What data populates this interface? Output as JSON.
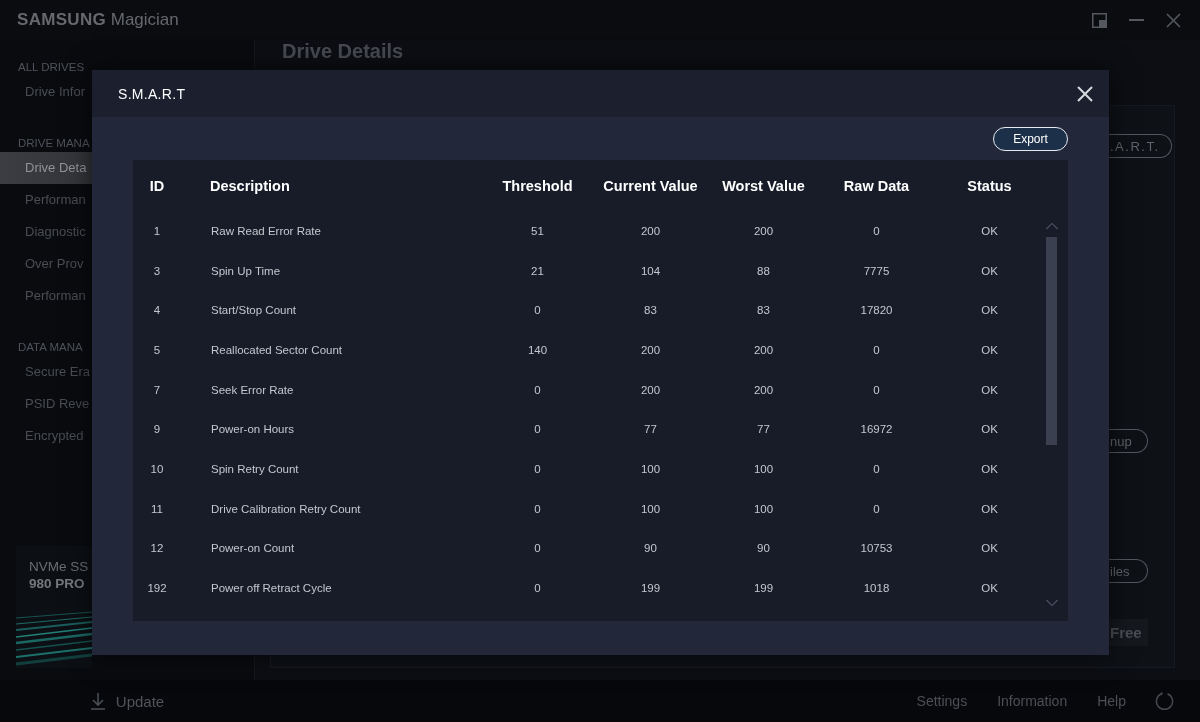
{
  "window": {
    "brand": "SAMSUNG",
    "title": "Magician"
  },
  "sidebar": {
    "sections": [
      {
        "heading": "ALL DRIVES",
        "items": [
          {
            "label": "Drive Infor",
            "selected": false
          }
        ]
      },
      {
        "heading": "DRIVE MANA",
        "items": [
          {
            "label": "Drive Deta",
            "selected": true
          },
          {
            "label": "Performan",
            "selected": false
          },
          {
            "label": "Diagnostic",
            "selected": false
          },
          {
            "label": "Over Prov",
            "selected": false
          },
          {
            "label": "Performan",
            "selected": false
          }
        ]
      },
      {
        "heading": "DATA MANA",
        "items": [
          {
            "label": "Secure Era",
            "selected": false
          },
          {
            "label": "PSID Reve",
            "selected": false
          },
          {
            "label": "Encrypted",
            "selected": false
          }
        ]
      }
    ],
    "banner": {
      "lines": [
        "NVMe SS",
        "980 PRO"
      ]
    },
    "update_button": "Update"
  },
  "main": {
    "heading": "Drive Details",
    "buttons": [
      ".A.R.T.",
      "nup",
      "iles"
    ],
    "free_label": "Free"
  },
  "dialog": {
    "title": "S.M.A.R.T",
    "export_button": "Export",
    "table": {
      "columns": [
        "ID",
        "Description",
        "Threshold",
        "Current Value",
        "Worst Value",
        "Raw Data",
        "Status"
      ],
      "rows": [
        [
          "1",
          "Raw Read Error Rate",
          "51",
          "200",
          "200",
          "0",
          "OK"
        ],
        [
          "3",
          "Spin Up Time",
          "21",
          "104",
          "88",
          "7775",
          "OK"
        ],
        [
          "4",
          "Start/Stop Count",
          "0",
          "83",
          "83",
          "17820",
          "OK"
        ],
        [
          "5",
          "Reallocated Sector Count",
          "140",
          "200",
          "200",
          "0",
          "OK"
        ],
        [
          "7",
          "Seek Error Rate",
          "0",
          "200",
          "200",
          "0",
          "OK"
        ],
        [
          "9",
          "Power-on Hours",
          "0",
          "77",
          "77",
          "16972",
          "OK"
        ],
        [
          "10",
          "Spin Retry Count",
          "0",
          "100",
          "100",
          "0",
          "OK"
        ],
        [
          "11",
          "Drive Calibration Retry Count",
          "0",
          "100",
          "100",
          "0",
          "OK"
        ],
        [
          "12",
          "Power-on Count",
          "0",
          "90",
          "90",
          "10753",
          "OK"
        ],
        [
          "192",
          "Power off Retract Cycle",
          "0",
          "199",
          "199",
          "1018",
          "OK"
        ]
      ]
    }
  },
  "footer": {
    "links": [
      "Settings",
      "Information",
      "Help"
    ]
  }
}
